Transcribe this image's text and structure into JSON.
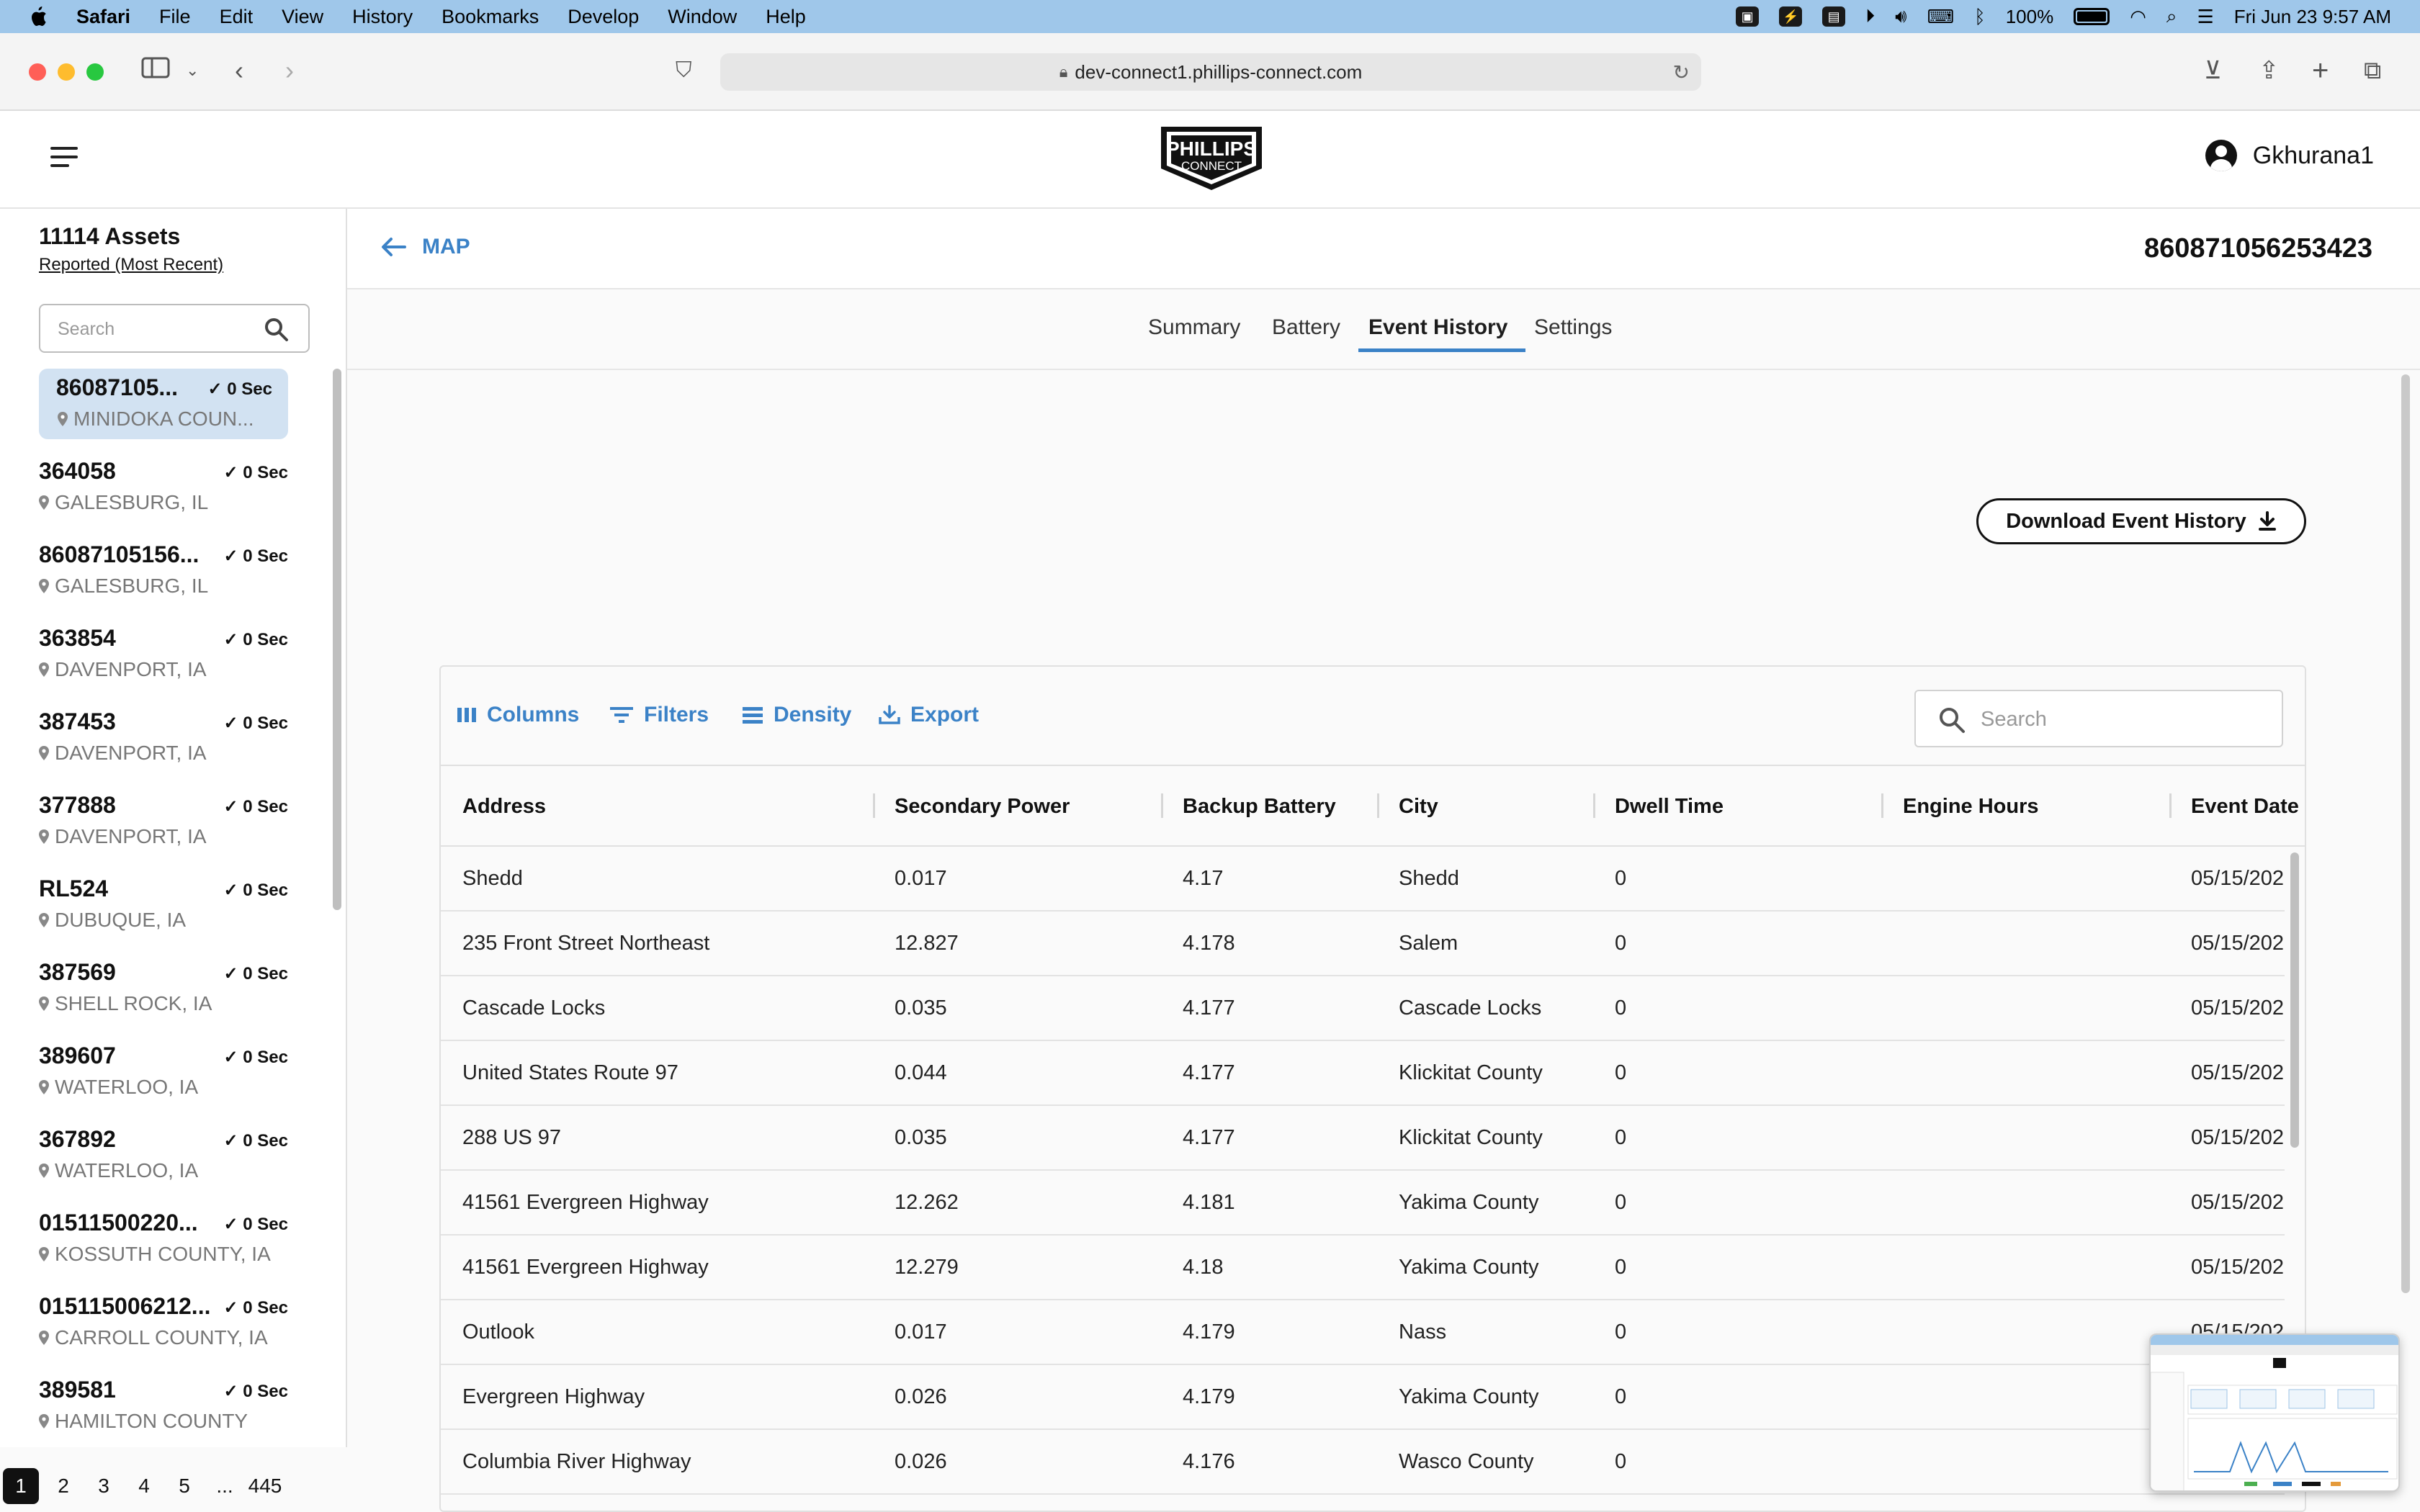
{
  "menubar": {
    "app": "Safari",
    "items": [
      "File",
      "Edit",
      "View",
      "History",
      "Bookmarks",
      "Develop",
      "Window",
      "Help"
    ],
    "battery": "100%",
    "datetime": "Fri Jun 23  9:57 AM"
  },
  "browser": {
    "url": "dev-connect1.phillips-connect.com"
  },
  "header": {
    "logo_line1": "PHILLIPS",
    "logo_line2": "CONNECT",
    "username": "Gkhurana1"
  },
  "sidebar": {
    "count": "11114 Assets",
    "sort": "Reported (Most Recent)",
    "search_placeholder": "Search",
    "assets": [
      {
        "id": "86087105...",
        "time": "0 Sec",
        "location": "MINIDOKA COUN..."
      },
      {
        "id": "364058",
        "time": "0 Sec",
        "location": "GALESBURG, IL"
      },
      {
        "id": "86087105156...",
        "time": "0 Sec",
        "location": "GALESBURG, IL"
      },
      {
        "id": "363854",
        "time": "0 Sec",
        "location": "DAVENPORT, IA"
      },
      {
        "id": "387453",
        "time": "0 Sec",
        "location": "DAVENPORT, IA"
      },
      {
        "id": "377888",
        "time": "0 Sec",
        "location": "DAVENPORT, IA"
      },
      {
        "id": "RL524",
        "time": "0 Sec",
        "location": "DUBUQUE, IA"
      },
      {
        "id": "387569",
        "time": "0 Sec",
        "location": "SHELL ROCK, IA"
      },
      {
        "id": "389607",
        "time": "0 Sec",
        "location": "WATERLOO, IA"
      },
      {
        "id": "367892",
        "time": "0 Sec",
        "location": "WATERLOO, IA"
      },
      {
        "id": "01511500220...",
        "time": "0 Sec",
        "location": "KOSSUTH COUNTY, IA"
      },
      {
        "id": "015115006212...",
        "time": "0 Sec",
        "location": "CARROLL COUNTY, IA"
      },
      {
        "id": "389581",
        "time": "0 Sec",
        "location": "HAMILTON COUNTY"
      }
    ],
    "pages": [
      "1",
      "2",
      "3",
      "4",
      "5",
      "...",
      "445"
    ]
  },
  "detail": {
    "back_label": "MAP",
    "device_id": "860871056253423",
    "tabs": [
      "Summary",
      "Battery",
      "Event History",
      "Settings"
    ],
    "active_tab": "Event History",
    "download_label": "Download Event History"
  },
  "grid": {
    "tools": [
      "Columns",
      "Filters",
      "Density",
      "Export"
    ],
    "search_placeholder": "Search",
    "columns": [
      "Address",
      "Secondary Power",
      "Backup Battery",
      "City",
      "Dwell Time",
      "Engine Hours",
      "Event Date"
    ],
    "rows": [
      [
        "Shedd",
        "0.017",
        "4.17",
        "Shedd",
        "0",
        "",
        "05/15/202"
      ],
      [
        "235 Front Street Northeast",
        "12.827",
        "4.178",
        "Salem",
        "0",
        "",
        "05/15/202"
      ],
      [
        "Cascade Locks",
        "0.035",
        "4.177",
        "Cascade Locks",
        "0",
        "",
        "05/15/202"
      ],
      [
        "United States Route 97",
        "0.044",
        "4.177",
        "Klickitat County",
        "0",
        "",
        "05/15/202"
      ],
      [
        "288 US 97",
        "0.035",
        "4.177",
        "Klickitat County",
        "0",
        "",
        "05/15/202"
      ],
      [
        "41561 Evergreen Highway",
        "12.262",
        "4.181",
        "Yakima County",
        "0",
        "",
        "05/15/202"
      ],
      [
        "41561 Evergreen Highway",
        "12.279",
        "4.18",
        "Yakima County",
        "0",
        "",
        "05/15/202"
      ],
      [
        "Outlook",
        "0.017",
        "4.179",
        "Nass",
        "0",
        "",
        "05/15/202"
      ],
      [
        "Evergreen Highway",
        "0.026",
        "4.179",
        "Yakima County",
        "0",
        "",
        ""
      ],
      [
        "Columbia River Highway",
        "0.026",
        "4.176",
        "Wasco County",
        "0",
        "",
        ""
      ]
    ]
  },
  "colors": {
    "accent": "#3b82c7",
    "menubar": "#9fc7ea",
    "selected_asset": "#d2e2f2"
  }
}
